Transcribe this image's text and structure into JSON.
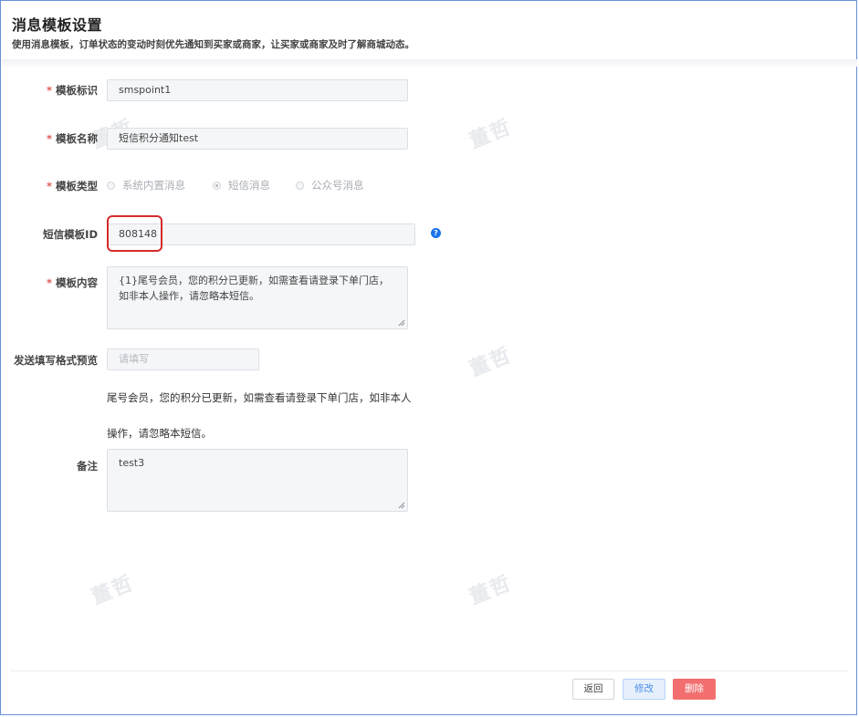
{
  "header": {
    "title": "消息模板设置",
    "description": "使用消息模板，订单状态的变动时刻优先通知到买家或商家，让买家或商家及时了解商城动态。"
  },
  "form": {
    "template_id_label": "模板标识",
    "template_id_value": "smspoint1",
    "template_name_label": "模板名称",
    "template_name_value": "短信积分通知test",
    "template_type_label": "模板类型",
    "template_type_options": [
      "系统内置消息",
      "短信消息",
      "公众号消息"
    ],
    "template_type_selected": "短信消息",
    "sms_template_id_label": "短信模板ID",
    "sms_template_id_value": "808148",
    "content_label": "模板内容",
    "content_value": "{1}尾号会员，您的积分已更新，如需查看请登录下单门店，如非本人操作，请忽略本短信。",
    "preview_label": "发送填写格式预览",
    "preview_placeholder": "请填写",
    "preview_text": "尾号会员，您的积分已更新，如需查看请登录下单门店，如非本人操作，请忽略本短信。",
    "remark_label": "备注",
    "remark_value": "test3",
    "required_mark": "*"
  },
  "help_icon_glyph": "?",
  "buttons": {
    "back": "返回",
    "edit": "修改",
    "delete": "删除"
  },
  "watermark": "董哲",
  "colors": {
    "required": "#e15a5a",
    "highlight": "#d62b2b",
    "primary": "#4a8fe7",
    "danger": "#f36f6f"
  }
}
